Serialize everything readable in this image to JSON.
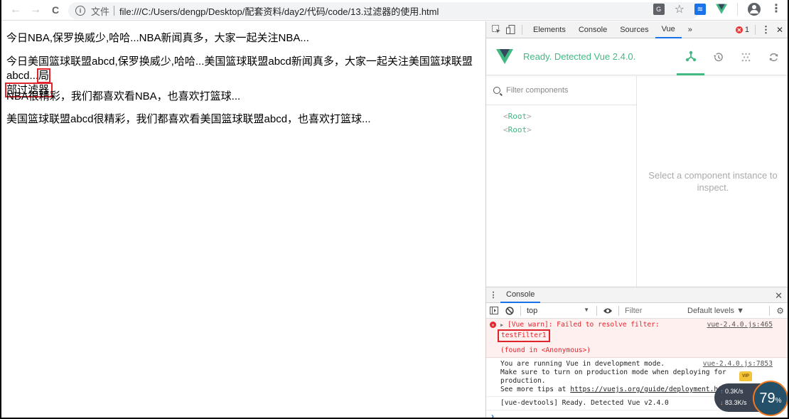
{
  "browser": {
    "nav": {
      "back_icon": "←",
      "forward_icon": "→",
      "reload_icon": "C"
    },
    "omnibox": {
      "info_icon": "i",
      "scheme_label": "文件",
      "url": "file:///C:/Users/dengp/Desktop/配套资料/day2/代码/code/13.过滤器的使用.html"
    },
    "extensions": {
      "translate_icon": "G",
      "star_icon": "☆",
      "blue_ext_icon": "≋",
      "kebab_icon": "⋮"
    }
  },
  "page": {
    "lines": [
      "今日NBA,保罗换威少,哈哈...NBA新闻真多，大家一起关注NBA...",
      "今日美国篮球联盟abcd,保罗换威少,哈哈...美国篮球联盟abcd新闻真多，大家一起关注美国篮球联盟abcd...",
      "NBA很精彩，我们都喜欢看NBA，也喜欢打篮球...",
      "美国篮球联盟abcd很精彩，我们都喜欢看美国篮球联盟abcd，也喜欢打篮球..."
    ],
    "annotation_part1": "局",
    "annotation_part2": "部过滤器"
  },
  "devtools": {
    "tabs": [
      {
        "label": "Elements",
        "active": false
      },
      {
        "label": "Console",
        "active": false
      },
      {
        "label": "Sources",
        "active": false
      },
      {
        "label": "Vue",
        "active": true
      }
    ],
    "more_tabs_icon": "»",
    "error_count": "1",
    "kebab_icon": "⋮",
    "close_icon": "✕",
    "vue": {
      "status": "Ready. Detected Vue 2.4.0.",
      "actions": [
        {
          "name": "components",
          "icon": "⅄",
          "active": true
        },
        {
          "name": "vuex",
          "icon": "↺",
          "active": false
        },
        {
          "name": "events",
          "icon": "⁙",
          "active": false
        },
        {
          "name": "refresh",
          "icon": "⟳",
          "active": false
        }
      ],
      "filter_placeholder": "Filter components",
      "tree": [
        {
          "open": "<",
          "name": "Root",
          "close": ">"
        },
        {
          "open": "<",
          "name": "Root",
          "close": ">"
        }
      ],
      "empty_inspector": "Select a component instance to inspect."
    },
    "drawer": {
      "tab_label": "Console",
      "close_icon": "✕",
      "toolbar": {
        "context": "top",
        "context_arrow": "▼",
        "filter_placeholder": "Filter",
        "levels": "Default levels ▼",
        "gear_icon": "⚙"
      },
      "messages": [
        {
          "type": "error",
          "text": "[Vue warn]: Failed to resolve filter:",
          "detail": "testFilter1",
          "found": "(found in <Anonymous>)",
          "source": "vue-2.4.0.js:465"
        },
        {
          "type": "info",
          "line1": "You are running Vue in development mode.",
          "line2": "Make sure to turn on production mode when deploying for production.",
          "line3_prefix": "See more tips at ",
          "line3_link": "https://vuejs.org/guide/deployment.html",
          "source": "vue-2.4.0.js:7853"
        },
        {
          "type": "info",
          "text": "[vue-devtools] Ready. Detected Vue v2.4.0"
        }
      ],
      "prompt": "›"
    }
  },
  "net_widget": {
    "upload": "0.3K/s",
    "download": "83.3K/s",
    "percent": "79",
    "percent_sign": "%",
    "up_arrow": "↑",
    "down_arrow": "↓",
    "crown_label": "VIP"
  }
}
